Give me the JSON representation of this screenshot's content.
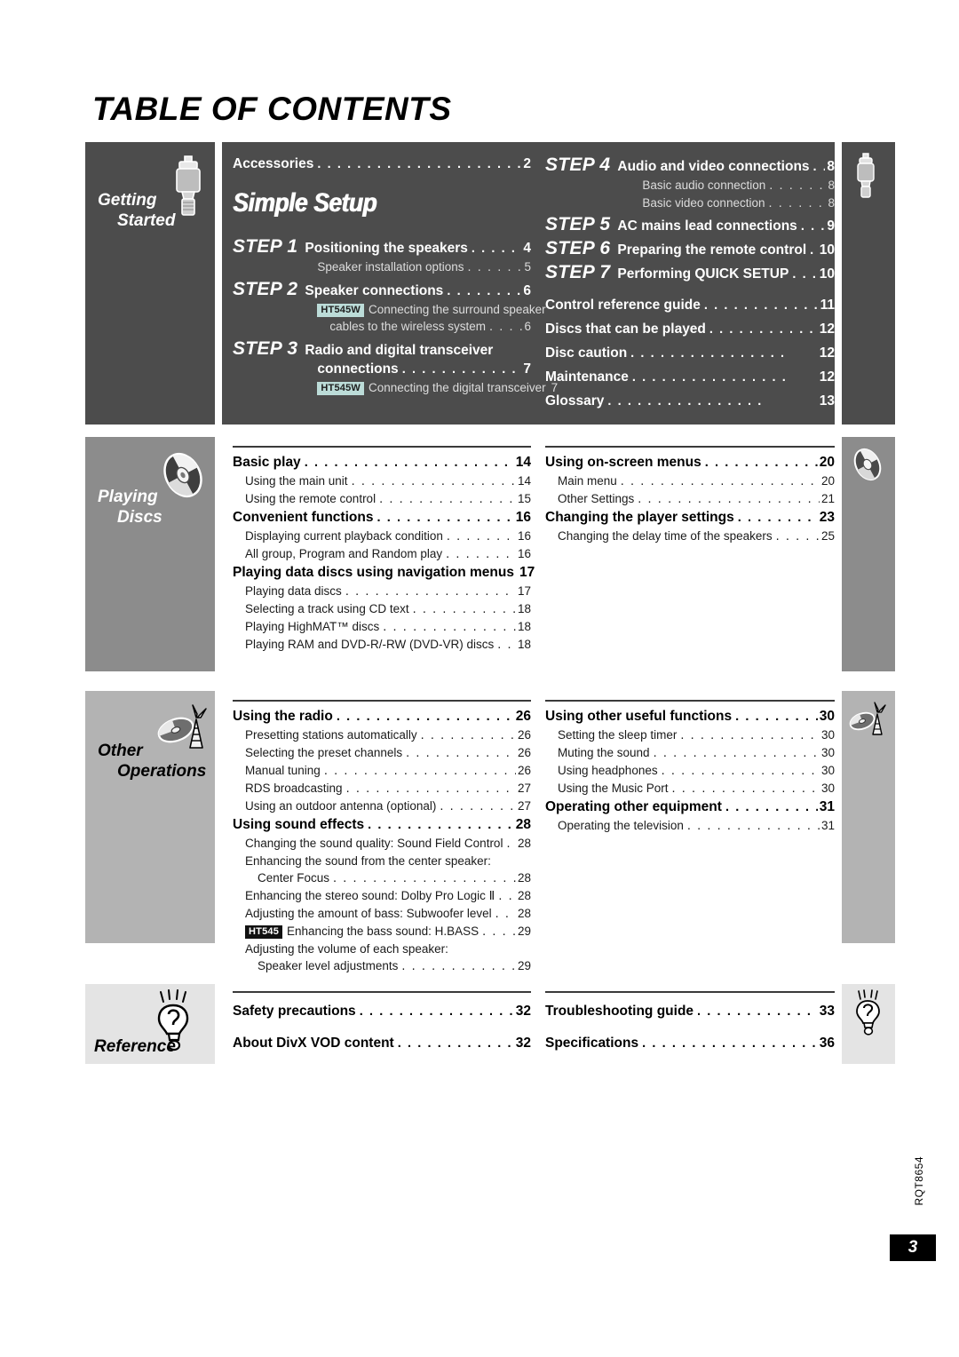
{
  "page": {
    "title": "TABLE OF CONTENTS",
    "doc_code": "RQT8654",
    "page_number": "3"
  },
  "colors": {
    "getting_started_bg": "#4c4c4c",
    "playing_discs_bg": "#8c8c8c",
    "other_operations_bg": "#b3b3b3",
    "reference_bg": "#e4e4e4",
    "badge_ht545w_bg": "#bcdcd8",
    "badge_ht545_bg": "#111111"
  },
  "sections": [
    {
      "id": "getting-started",
      "tab_label_line1": "Getting",
      "tab_label_line2": "Started",
      "icon": "plug-connector-icon",
      "banner": "Simple Setup",
      "left_column": [
        {
          "kind": "plain-main",
          "text": "Accessories",
          "page": "2"
        }
      ],
      "steps_left": [
        {
          "step": "STEP 1",
          "title": "Positioning the speakers",
          "page": "4",
          "subs": [
            {
              "text": "Speaker installation options",
              "page": "5",
              "badge": ""
            }
          ]
        },
        {
          "step": "STEP 2",
          "title": "Speaker connections",
          "page": "6",
          "subs": [
            {
              "badge": "HT545W",
              "text": "Connecting the surround speaker",
              "text2": "cables to the wireless system",
              "page": "6"
            }
          ]
        },
        {
          "step": "STEP 3",
          "title": "Radio and digital transceiver",
          "title2": "connections",
          "page": "7",
          "subs": [
            {
              "badge": "HT545W",
              "text": "Connecting the digital transceiver",
              "page": "7"
            }
          ]
        }
      ],
      "steps_right": [
        {
          "step": "STEP 4",
          "title": "Audio and video connections",
          "page": "8",
          "subs": [
            {
              "text": "Basic audio connection",
              "page": "8"
            },
            {
              "text": "Basic video connection",
              "page": "8"
            }
          ]
        },
        {
          "step": "STEP 5",
          "title": "AC mains lead connections",
          "page": "9",
          "subs": []
        },
        {
          "step": "STEP 6",
          "title": "Preparing the remote control",
          "page": "10",
          "subs": []
        },
        {
          "step": "STEP 7",
          "title": "Performing QUICK SETUP",
          "page": "10",
          "subs": []
        }
      ],
      "right_column": [
        {
          "text": "Control reference guide",
          "page": "11"
        },
        {
          "text": "Discs that can be played",
          "page": "12"
        },
        {
          "text": "Disc caution",
          "page": "12"
        },
        {
          "text": "Maintenance",
          "page": "12"
        },
        {
          "text": "Glossary",
          "page": "13"
        }
      ]
    },
    {
      "id": "playing-discs",
      "tab_label_line1": "Playing",
      "tab_label_line2": "Discs",
      "icon": "disc-icon",
      "left_column": [
        {
          "level": "main",
          "text": "Basic play",
          "page": "14"
        },
        {
          "level": "sub",
          "text": "Using the main unit",
          "page": "14"
        },
        {
          "level": "sub",
          "text": "Using the remote control",
          "page": "15"
        },
        {
          "level": "main",
          "text": "Convenient functions",
          "page": "16"
        },
        {
          "level": "sub",
          "text": "Displaying current playback condition",
          "page": "16"
        },
        {
          "level": "sub",
          "text": "All group, Program and Random play",
          "page": "16"
        },
        {
          "level": "main",
          "text": "Playing data discs using navigation menus",
          "page": "17"
        },
        {
          "level": "sub",
          "text": "Playing data discs",
          "page": "17"
        },
        {
          "level": "sub",
          "text": "Selecting a track using CD text",
          "page": "18"
        },
        {
          "level": "sub",
          "text": "Playing HighMAT™ discs",
          "page": "18"
        },
        {
          "level": "sub",
          "text": "Playing RAM and DVD-R/-RW (DVD-VR) discs",
          "page": "18"
        }
      ],
      "right_column": [
        {
          "level": "main",
          "text": "Using on-screen menus",
          "page": "20"
        },
        {
          "level": "sub",
          "text": "Main menu",
          "page": "20"
        },
        {
          "level": "sub",
          "text": "Other Settings",
          "page": "21"
        },
        {
          "level": "main",
          "text": "Changing the player settings",
          "page": "23"
        },
        {
          "level": "sub",
          "text": "Changing the delay time of the speakers",
          "page": "25"
        }
      ]
    },
    {
      "id": "other-operations",
      "tab_label_line1": "Other",
      "tab_label_line2": "Operations",
      "icon": "disc-antenna-icon",
      "left_column": [
        {
          "level": "main",
          "text": "Using the radio",
          "page": "26"
        },
        {
          "level": "sub",
          "text": "Presetting stations automatically",
          "page": "26"
        },
        {
          "level": "sub",
          "text": "Selecting the preset channels",
          "page": "26"
        },
        {
          "level": "sub",
          "text": "Manual tuning",
          "page": "26"
        },
        {
          "level": "sub",
          "text": "RDS broadcasting",
          "page": "27"
        },
        {
          "level": "sub",
          "text": "Using an outdoor antenna (optional)",
          "page": "27"
        },
        {
          "level": "main",
          "text": "Using sound effects",
          "page": "28"
        },
        {
          "level": "sub",
          "text": "Changing the sound quality: Sound Field Control",
          "page": "28"
        },
        {
          "level": "sub-nodots",
          "text": "Enhancing the sound from the center speaker:",
          "page": ""
        },
        {
          "level": "sub-indent",
          "text": "Center Focus",
          "page": "28"
        },
        {
          "level": "sub",
          "text": "Enhancing the stereo sound: Dolby Pro Logic Ⅱ",
          "page": "28"
        },
        {
          "level": "sub",
          "text": "Adjusting the amount of bass: Subwoofer level",
          "page": "28"
        },
        {
          "level": "sub-badge",
          "badge": "HT545",
          "text": "Enhancing the bass sound: H.BASS",
          "page": "29"
        },
        {
          "level": "sub-nodots",
          "text": "Adjusting the volume of each speaker:",
          "page": ""
        },
        {
          "level": "sub-indent",
          "text": "Speaker level adjustments",
          "page": "29"
        }
      ],
      "right_column": [
        {
          "level": "main",
          "text": "Using other useful functions",
          "page": "30"
        },
        {
          "level": "sub",
          "text": "Setting the sleep timer",
          "page": "30"
        },
        {
          "level": "sub",
          "text": "Muting the sound",
          "page": "30"
        },
        {
          "level": "sub",
          "text": "Using headphones",
          "page": "30"
        },
        {
          "level": "sub",
          "text": "Using the Music Port",
          "page": "30"
        },
        {
          "level": "main",
          "text": "Operating other equipment",
          "page": "31"
        },
        {
          "level": "sub",
          "text": "Operating the television",
          "page": "31"
        }
      ]
    },
    {
      "id": "reference",
      "tab_label_line1": "Reference",
      "tab_label_line2": "",
      "icon": "lightbulb-idea-icon",
      "left_column": [
        {
          "level": "main",
          "text": "Safety precautions",
          "page": "32"
        },
        {
          "level": "main",
          "text": "About DivX VOD content",
          "page": "32"
        }
      ],
      "right_column": [
        {
          "level": "main",
          "text": "Troubleshooting guide",
          "page": "33"
        },
        {
          "level": "main",
          "text": "Specifications",
          "page": "36"
        }
      ]
    }
  ]
}
